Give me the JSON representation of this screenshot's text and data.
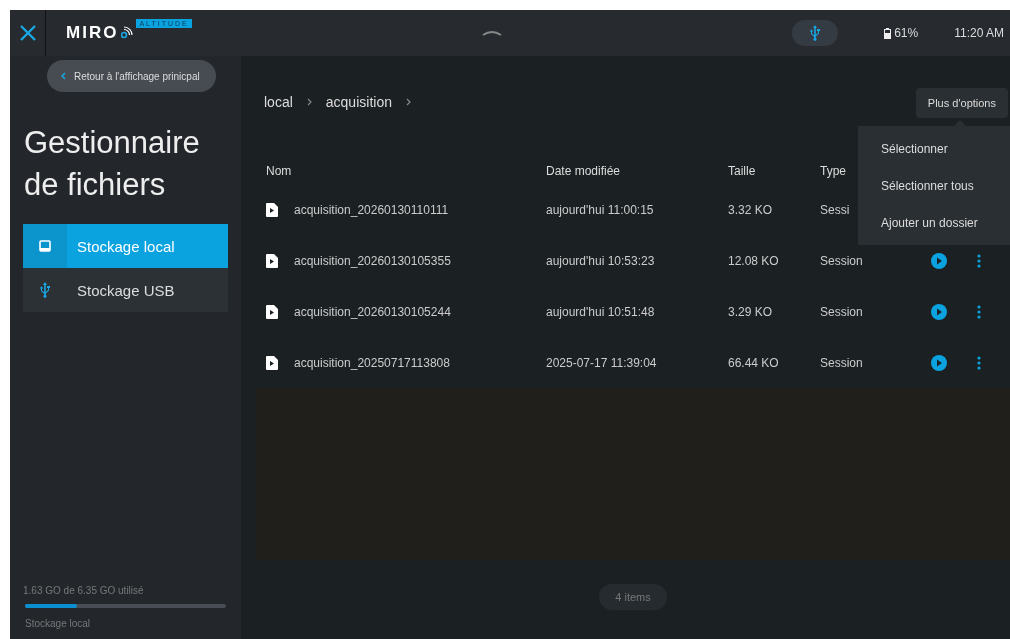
{
  "topbar": {
    "logo": "MIRO",
    "logo_tag": "ALTITUDE",
    "battery": "61%",
    "time": "11:20 AM"
  },
  "back_button": "Retour à l'affichage prinicpal",
  "title": "Gestionnaire de fichiers",
  "sidebar": {
    "items": [
      {
        "label": "Stockage local",
        "kind": "local",
        "selected": true
      },
      {
        "label": "Stockage USB",
        "kind": "usb",
        "selected": false
      }
    ]
  },
  "storage": {
    "usage": "1.63 GO de 6.35 GO utilisé",
    "level": 0.257,
    "label": "Stockage local"
  },
  "breadcrumb": [
    "local",
    "acquisition"
  ],
  "options_button": "Plus d'options",
  "menu": [
    "Sélectionner",
    "Sélectionner tous",
    "Ajouter un dossier"
  ],
  "table": {
    "columns": [
      "Nom",
      "Date modifiée",
      "Taille",
      "Type"
    ],
    "rows": [
      {
        "name": "acquisition_20260130110111",
        "date": "aujourd'hui 11:00:15",
        "size": "3.32 KO",
        "type": "Sessi"
      },
      {
        "name": "acquisition_20260130105355",
        "date": "aujourd'hui 10:53:23",
        "size": "12.08 KO",
        "type": "Session",
        "actions": [
          {
            "kind": "play"
          },
          {
            "kind": "more"
          }
        ]
      },
      {
        "name": "acquisition_20260130105244",
        "date": "aujourd'hui 10:51:48",
        "size": "3.29 KO",
        "type": "Session",
        "actions": [
          {
            "kind": "play"
          },
          {
            "kind": "more"
          }
        ]
      },
      {
        "name": "acquisition_20250717113808",
        "date": "2025-07-17 11:39:04",
        "size": "66.44 KO",
        "type": "Session",
        "actions": [
          {
            "kind": "play"
          },
          {
            "kind": "more"
          }
        ]
      }
    ]
  },
  "item_count": "4 items"
}
